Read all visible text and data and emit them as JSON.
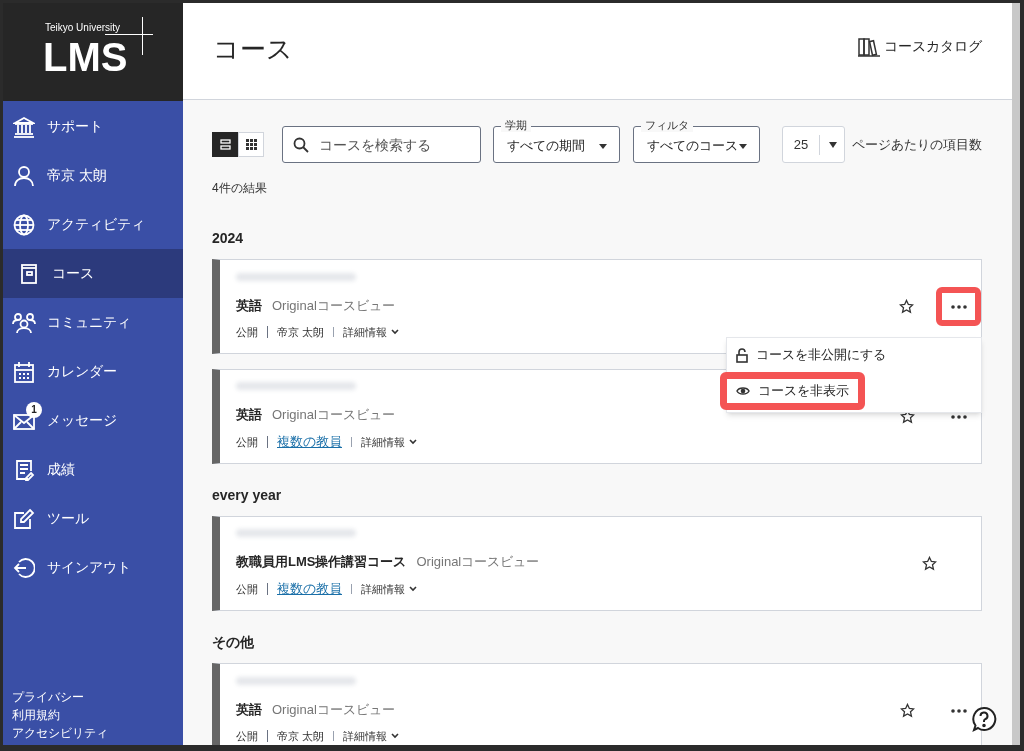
{
  "sidebar": {
    "logo": {
      "caption": "Teikyo University",
      "wordmark": "LMS"
    },
    "items": [
      {
        "label": "サポート",
        "selected": false
      },
      {
        "label": "帝京 太朗",
        "selected": false
      },
      {
        "label": "アクティビティ",
        "selected": false
      },
      {
        "label": "コース",
        "selected": true
      },
      {
        "label": "コミュニティ",
        "selected": false
      },
      {
        "label": "カレンダー",
        "selected": false
      },
      {
        "label": "メッセージ",
        "selected": false,
        "badge": "1"
      },
      {
        "label": "成績",
        "selected": false
      },
      {
        "label": "ツール",
        "selected": false
      },
      {
        "label": "サインアウト",
        "selected": false
      }
    ],
    "footer_links": [
      "プライバシー",
      "利用規約",
      "アクセシビリティ"
    ]
  },
  "header": {
    "title": "コース",
    "catalog_link": "コースカタログ"
  },
  "toolbar": {
    "view_toggle": [
      {
        "selected": true
      },
      {
        "selected": false
      }
    ],
    "search": {
      "placeholder": "コースを検索する"
    },
    "term": {
      "label": "学期",
      "value": "すべての期間"
    },
    "filter": {
      "label": "フィルタ",
      "value": "すべてのコース"
    },
    "per_page": {
      "value": "25",
      "label": "ページあたりの項目数"
    }
  },
  "result_count": "4件の結果",
  "groups": [
    {
      "heading": "2024",
      "courses": [
        {
          "title": "英語",
          "view": "Originalコースビュー",
          "status": "公開",
          "instructor": "帝京 太朗",
          "instructor_link": false,
          "details": "詳細情報",
          "more_button": {
            "highlighted": true
          },
          "options_menu": {
            "items": [
              {
                "label": "コースを非公開にする",
                "highlighted": false
              },
              {
                "label": "コースを非表示",
                "highlighted": true
              }
            ]
          }
        },
        {
          "title": "英語",
          "view": "Originalコースビュー",
          "status": "公開",
          "instructor": "複数の教員",
          "instructor_link": true,
          "details": "詳細情報",
          "more_button": {
            "highlighted": false
          }
        }
      ]
    },
    {
      "heading": "every year",
      "courses": [
        {
          "title": "教職員用LMS操作講習コース",
          "view": "Originalコースビュー",
          "status": "公開",
          "instructor": "複数の教員",
          "instructor_link": true,
          "details": "詳細情報"
        }
      ]
    },
    {
      "heading": "その他",
      "courses": [
        {
          "title": "英語",
          "view": "Originalコースビュー",
          "status": "公開",
          "instructor": "帝京 太朗",
          "instructor_link": false,
          "details": "詳細情報",
          "more_button": {
            "highlighted": false
          }
        }
      ]
    }
  ]
}
